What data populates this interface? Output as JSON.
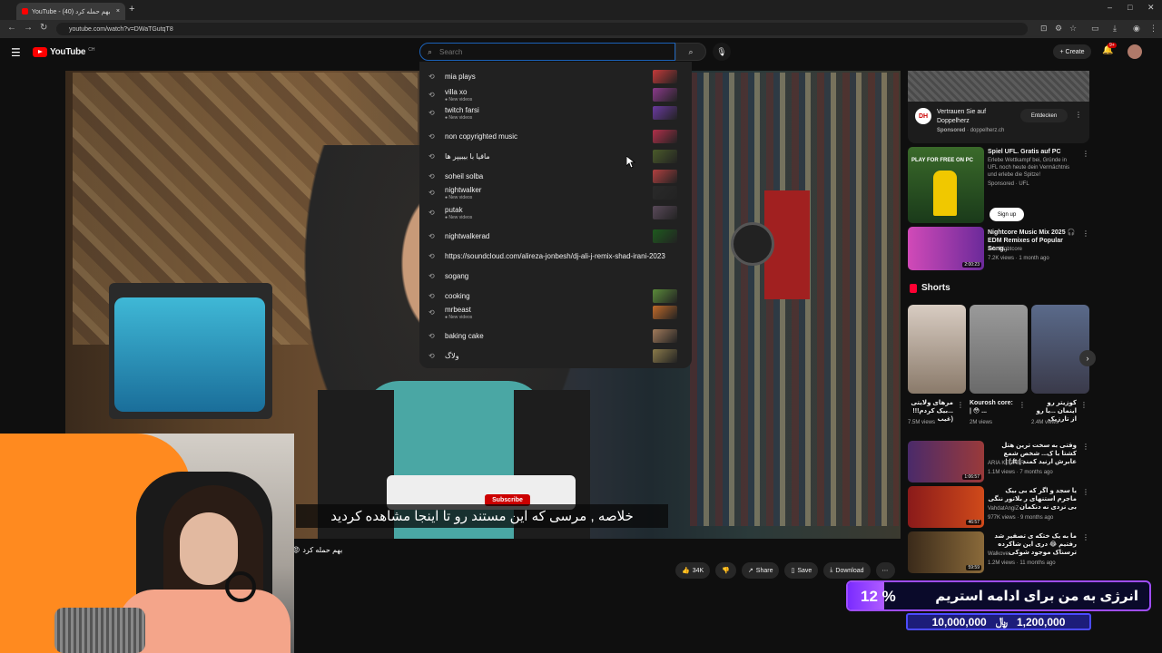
{
  "browser": {
    "tab_title": "بهم حمله کرد (40) - YouTube",
    "new_tab": "+",
    "url": "youtube.com/watch?v=DWaTGutqT8"
  },
  "header": {
    "logo_text": "YouTube",
    "country": "CH",
    "search_placeholder": "Search",
    "create_label": "Create",
    "notif_count": "9+"
  },
  "search_suggestions": [
    {
      "text": "mia plays",
      "sub": "",
      "thumb": "#c43a3a"
    },
    {
      "text": "villa xo",
      "sub": "New videos",
      "thumb": "#8a3a8a"
    },
    {
      "text": "twitch farsi",
      "sub": "New videos",
      "thumb": "#6a3aa0"
    },
    {
      "text": "non copyrighted music",
      "sub": "",
      "thumb": "#b0304a"
    },
    {
      "text": "مافیا با بیبیپر ها",
      "sub": "",
      "thumb": "#4a5a2a"
    },
    {
      "text": "soheil solba",
      "sub": "",
      "thumb": "#b04040"
    },
    {
      "text": "nightwalker",
      "sub": "New videos",
      "thumb": "#2a2a2a"
    },
    {
      "text": "putak",
      "sub": "New videos",
      "thumb": "#5a4a5a"
    },
    {
      "text": "nightwalkerad",
      "sub": "",
      "thumb": "#1e5a1e"
    },
    {
      "text": "https://soundcloud.com/alireza-jonbesh/dj-ali-j-remix-shad-irani-2023",
      "sub": "",
      "thumb": ""
    },
    {
      "text": "sogang",
      "sub": "",
      "thumb": ""
    },
    {
      "text": "cooking",
      "sub": "",
      "thumb": "#5a8a3a"
    },
    {
      "text": "mrbeast",
      "sub": "New videos",
      "thumb": "#c06a2a"
    },
    {
      "text": "baking cake",
      "sub": "",
      "thumb": "#a07a5a"
    },
    {
      "text": "ولاگ",
      "sub": "",
      "thumb": "#8a7a4a"
    }
  ],
  "video": {
    "subscribe_label": "Subscribe",
    "subtitle": "خلاصه , مرسی که این مستند رو تا اینجا مشاهده کردید",
    "title": "بهم حمله کرد",
    "actions": {
      "like_count": "34K",
      "share": "Share",
      "save": "Save",
      "download": "Download"
    }
  },
  "ad_top": {
    "logo": "DH",
    "title": "Vertrauen Sie auf Doppelherz",
    "sponsored": "Sponsored",
    "domain": "doppelherz.ch",
    "cta": "Entdecken"
  },
  "recommendations": [
    {
      "title": "Spiel UFL. Gratis auf PC",
      "desc": "Erlebe Wettkampf bei, Gründe in UFL noch heute dein Vermächtnis und erlebe die Spitze!",
      "meta": "Sponsored · UFL",
      "thumb_text": "PLAY FOR FREE ON PC",
      "cta": "Sign up",
      "duration": ""
    },
    {
      "title": "Nightcore Music Mix 2025 🎧 EDM Remixes of Popular Song...",
      "desc": "",
      "meta": "Aria Nightcore",
      "meta2": "7.2K views · 1 month ago",
      "duration": "2:00:23"
    }
  ],
  "shorts": {
    "label": "Shorts",
    "items": [
      {
        "title": "مرهای ولایتی ...بیک کردم!!!(غیب",
        "views": "7.5M views"
      },
      {
        "title": "Kourosh core: | 😳 ...",
        "views": "2M views"
      },
      {
        "title": "کوزیتر رو اینمان ...یا رو از تارزیک",
        "views": "2.4M views"
      }
    ]
  },
  "more_videos": [
    {
      "title": "وقتی به سخت ترین هتل کشتا با ک... شخص شمع عابرش ارنید کمند ) ft.) |",
      "channel": "ARIA KEOXER",
      "meta": "1.1M views · 7 months ago",
      "duration": "1:06:57"
    },
    {
      "title": "یا سجد و اگر که بی بیک ماجرم استنهای ر بلاتور ننگی بی نزدی نه دنکمان",
      "channel": "VahdatAngiZ",
      "meta": "977K views · 9 months ago",
      "duration": "46:57"
    },
    {
      "title": "ما به یک ختکه ی تصفیر شد رفتیم 😂 دری این شاکرده ترسناک موجود شوکی",
      "channel": "Walkover",
      "meta": "1.2M views · 11 months ago",
      "duration": "59:59"
    }
  ],
  "donation_goal": {
    "percent_label": "12 %",
    "fill_fraction": 0.12,
    "message": "انرژی به من برای ادامه استریم",
    "target": "10,000,000",
    "current": "1,200,000",
    "currency_symbol": "﷼"
  }
}
